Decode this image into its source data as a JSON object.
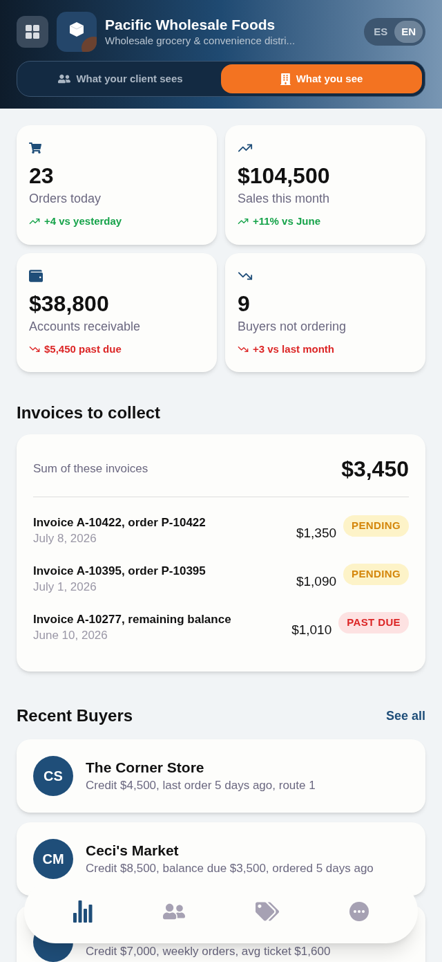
{
  "header": {
    "title": "Pacific Wholesale Foods",
    "subtitle": "Wholesale grocery & convenience distri...",
    "languages": [
      {
        "label": "ES",
        "selected": false
      },
      {
        "label": "EN",
        "selected": true
      }
    ],
    "view_tabs": [
      {
        "label": "What your client sees",
        "kind": "users",
        "selected": false
      },
      {
        "label": "What you see",
        "kind": "building",
        "selected": true
      }
    ]
  },
  "stats": [
    {
      "kind": "cart",
      "value": "23",
      "label": "Orders today",
      "trend": {
        "kind": "up",
        "text": "+4 vs yesterday"
      }
    },
    {
      "kind": "trend_up",
      "value": "$104,500",
      "label": "Sales this month",
      "trend": {
        "kind": "up",
        "text": "+11% vs June"
      }
    },
    {
      "kind": "wallet",
      "value": "$38,800",
      "label": "Accounts receivable",
      "trend": {
        "kind": "down",
        "text": "$5,450 past due"
      }
    },
    {
      "kind": "trend_down",
      "value": "9",
      "label": "Buyers not ordering",
      "trend": {
        "kind": "down",
        "text": "+3 vs last month"
      }
    }
  ],
  "invoices": {
    "title": "Invoices to collect",
    "sum_label": "Sum of these invoices",
    "sum": "$3,450",
    "rows": [
      {
        "title": "Invoice A-10422, order P-10422",
        "date": "July 8, 2026",
        "amount": "$1,350",
        "kind": "pending",
        "badge": "PENDING"
      },
      {
        "title": "Invoice A-10395, order P-10395",
        "date": "July 1, 2026",
        "amount": "$1,090",
        "kind": "pending",
        "badge": "PENDING"
      },
      {
        "title": "Invoice A-10277, remaining balance",
        "date": "June 10, 2026",
        "amount": "$1,010",
        "kind": "past_due",
        "badge": "PAST DUE"
      }
    ]
  },
  "buyers": {
    "title": "Recent Buyers",
    "link": "See all",
    "items": [
      {
        "initials": "CS",
        "name": "The Corner Store",
        "detail": "Credit $4,500, last order 5 days ago, route 1"
      },
      {
        "initials": "CM",
        "name": "Ceci's Market",
        "detail": "Credit $8,500, balance due $3,500, ordered 5 days ago"
      },
      {
        "detail": "Credit $7,000, weekly orders, avg ticket $1,600"
      }
    ]
  },
  "nav": [
    {
      "kind": "chart",
      "selected": true
    },
    {
      "kind": "users",
      "selected": false
    },
    {
      "kind": "tags",
      "selected": false
    },
    {
      "kind": "more",
      "selected": false
    }
  ]
}
